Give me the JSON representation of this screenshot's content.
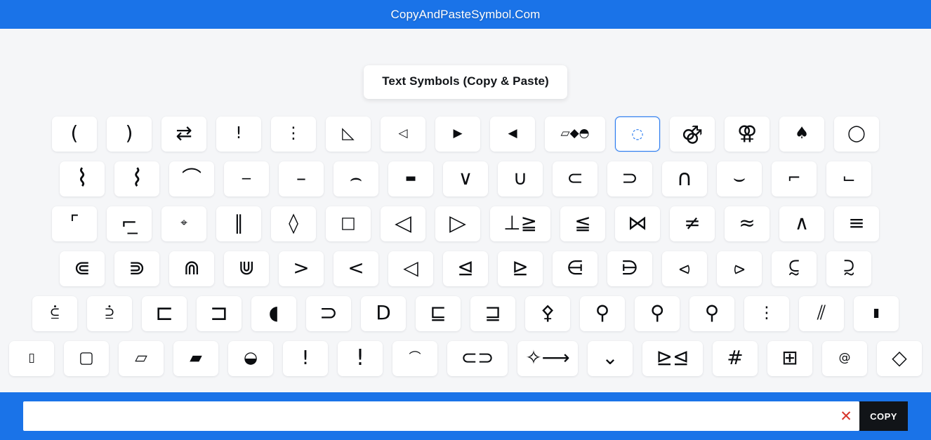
{
  "header": {
    "brand": "CopyAndPasteSymbol.Com",
    "background_color": "#1a73e8"
  },
  "title_card": {
    "heading": "Text Symbols (Copy & Paste)"
  },
  "theme": {
    "accent": "#1a73e8",
    "selected_border": "#2b7cf0",
    "page_bg": "#f5f6f8",
    "cell_bg": "#ffffff",
    "glyph_color": "#0b0d10",
    "clear_color": "#d7342a",
    "copy_bg": "#111418"
  },
  "grid": {
    "rows": [
      {
        "cells": [
          {
            "glyph": "(",
            "name": "symbol-left-paren",
            "size": "g-lg"
          },
          {
            "glyph": ")",
            "name": "symbol-right-paren",
            "size": "g-lg"
          },
          {
            "glyph": "⇄",
            "name": "symbol-rightleft-arrows",
            "size": "g-lg"
          },
          {
            "glyph": "!",
            "name": "symbol-exclamation",
            "size": ""
          },
          {
            "glyph": "⋮",
            "name": "symbol-vertical-ellipsis",
            "size": ""
          },
          {
            "glyph": "◺",
            "name": "symbol-lower-left-triangle",
            "size": ""
          },
          {
            "glyph": "◁",
            "name": "symbol-white-left-triangle",
            "size": "g-sm"
          },
          {
            "glyph": "▶",
            "name": "symbol-black-right-triangle",
            "size": "g-sm"
          },
          {
            "glyph": "◀",
            "name": "symbol-black-left-triangle",
            "size": "g-sm"
          },
          {
            "glyph": "▱◆◓",
            "name": "symbol-parallelogram-diamond-circle",
            "size": "g-sm",
            "wide": true
          },
          {
            "glyph": "◌",
            "name": "symbol-dotted-circle-selected",
            "size": "",
            "selected": true
          },
          {
            "glyph": "⚣",
            "name": "symbol-doubled-male",
            "size": "g-lg"
          },
          {
            "glyph": "⚢",
            "name": "symbol-doubled-female",
            "size": "g-lg"
          },
          {
            "glyph": "♠",
            "name": "symbol-spade",
            "size": ""
          },
          {
            "glyph": "◯",
            "name": "symbol-large-circle",
            "size": ""
          }
        ]
      },
      {
        "cells": [
          {
            "glyph": "⌇",
            "name": "symbol-wavy-line-down",
            "size": "g-tall"
          },
          {
            "glyph": "⌇",
            "name": "symbol-wavy-line-up",
            "size": "g-tall",
            "flip": true
          },
          {
            "glyph": "⌒",
            "name": "symbol-arc",
            "size": "g-lg"
          },
          {
            "glyph": "‒",
            "name": "symbol-figure-dash",
            "size": ""
          },
          {
            "glyph": "–",
            "name": "symbol-en-dash",
            "size": "g-lg"
          },
          {
            "glyph": "⌢",
            "name": "symbol-frown-arc",
            "size": "g-lg"
          },
          {
            "glyph": "▬",
            "name": "symbol-black-rectangle",
            "size": "g-sm"
          },
          {
            "glyph": "∨",
            "name": "symbol-logical-or",
            "size": "g-lg"
          },
          {
            "glyph": "∪",
            "name": "symbol-union",
            "size": "g-lg"
          },
          {
            "glyph": "⊂",
            "name": "symbol-subset-of",
            "size": "g-lg"
          },
          {
            "glyph": "⊃",
            "name": "symbol-superset-of",
            "size": "g-lg"
          },
          {
            "glyph": "∩",
            "name": "symbol-intersection",
            "size": "g-xl"
          },
          {
            "glyph": "⌣",
            "name": "symbol-smile-arc",
            "size": "g-lg"
          },
          {
            "glyph": "⌐",
            "name": "symbol-reversed-not",
            "size": ""
          },
          {
            "glyph": "⌙",
            "name": "symbol-turned-not",
            "size": ""
          }
        ]
      },
      {
        "cells": [
          {
            "glyph": "⌜",
            "name": "symbol-top-left-corner",
            "size": "g-lg"
          },
          {
            "glyph": "⌐̲",
            "name": "symbol-bottom-right-corner",
            "size": "g-lg"
          },
          {
            "glyph": "⌖",
            "name": "symbol-position-indicator",
            "size": "g-sm"
          },
          {
            "glyph": "∥",
            "name": "symbol-parallel-to",
            "size": "g-lg"
          },
          {
            "glyph": "◊",
            "name": "symbol-lozenge",
            "size": "g-lg"
          },
          {
            "glyph": "□",
            "name": "symbol-white-square",
            "size": ""
          },
          {
            "glyph": "◁",
            "name": "symbol-white-left-triangle-large",
            "size": "g-xl"
          },
          {
            "glyph": "▷",
            "name": "symbol-white-right-triangle-large",
            "size": "g-xl"
          },
          {
            "glyph": "⊥≧",
            "name": "symbol-perpendicular-greater-equal",
            "size": "g-lg",
            "wide": true
          },
          {
            "glyph": "≦",
            "name": "symbol-less-over-equal",
            "size": "g-lg"
          },
          {
            "glyph": "⋈",
            "name": "symbol-bowtie",
            "size": "g-lg"
          },
          {
            "glyph": "≠",
            "name": "symbol-not-equal",
            "size": "g-lg"
          },
          {
            "glyph": "≈",
            "name": "symbol-almost-equal",
            "size": "g-lg"
          },
          {
            "glyph": "∧",
            "name": "symbol-logical-and",
            "size": "g-lg"
          },
          {
            "glyph": "≡",
            "name": "symbol-identical-to",
            "size": "g-lg"
          }
        ]
      },
      {
        "cells": [
          {
            "glyph": "⋐",
            "name": "symbol-double-subset",
            "size": "g-lg"
          },
          {
            "glyph": "⋑",
            "name": "symbol-double-superset",
            "size": "g-lg"
          },
          {
            "glyph": "⋒",
            "name": "symbol-double-intersection",
            "size": "g-lg"
          },
          {
            "glyph": "⋓",
            "name": "symbol-double-union",
            "size": "g-lg"
          },
          {
            "glyph": ">",
            "name": "symbol-greater-than",
            "size": "g-lg"
          },
          {
            "glyph": "<",
            "name": "symbol-less-than",
            "size": "g-lg"
          },
          {
            "glyph": "◁",
            "name": "symbol-triangle-left-outline",
            "size": "g-lg"
          },
          {
            "glyph": "⊴",
            "name": "symbol-normal-subgroup-equal",
            "size": "g-lg"
          },
          {
            "glyph": "⊵",
            "name": "symbol-contains-normal-subgroup-equal",
            "size": "g-lg"
          },
          {
            "glyph": "⋳",
            "name": "symbol-element-with-dot",
            "size": "g-lg"
          },
          {
            "glyph": "⋻",
            "name": "symbol-contains-with-dot",
            "size": "g-lg"
          },
          {
            "glyph": "⪦",
            "name": "symbol-subset-with-plus",
            "size": "g-lg"
          },
          {
            "glyph": "⪧",
            "name": "symbol-superset-with-plus",
            "size": "g-lg"
          },
          {
            "glyph": "⫇",
            "name": "symbol-subset-with-times",
            "size": "g-lg"
          },
          {
            "glyph": "⫈",
            "name": "symbol-superset-with-times",
            "size": "g-lg"
          }
        ]
      },
      {
        "cells": [
          {
            "glyph": "⫃",
            "name": "symbol-subset-equal-dot",
            "size": "g-lg"
          },
          {
            "glyph": "⫄",
            "name": "symbol-superset-equal-dot",
            "size": "g-lg"
          },
          {
            "glyph": "⊏",
            "name": "symbol-square-image-of",
            "size": "g-xl"
          },
          {
            "glyph": "⊐",
            "name": "symbol-square-original-of",
            "size": "g-xl"
          },
          {
            "glyph": "◖",
            "name": "symbol-left-half-circle",
            "size": "g-lg"
          },
          {
            "glyph": "⊃",
            "name": "symbol-superset-plain",
            "size": "g-xl"
          },
          {
            "glyph": "D",
            "name": "symbol-letter-d-shape",
            "size": "g-lg"
          },
          {
            "glyph": "⊑",
            "name": "symbol-square-image-of-equal",
            "size": "g-lg"
          },
          {
            "glyph": "⊒",
            "name": "symbol-square-original-of-equal",
            "size": "g-lg"
          },
          {
            "glyph": "⚴",
            "name": "symbol-pallas",
            "size": "g-lg"
          },
          {
            "glyph": "⚲",
            "name": "symbol-neuter",
            "size": "g-lg"
          },
          {
            "glyph": "⚲",
            "name": "symbol-pin-up",
            "size": "g-lg",
            "flip": true
          },
          {
            "glyph": "⚲",
            "name": "symbol-pin-down",
            "size": "g-lg"
          },
          {
            "glyph": "⋮",
            "name": "symbol-vertical-ellipsis-2",
            "size": ""
          },
          {
            "glyph": "⫽",
            "name": "symbol-triple-solidus",
            "size": "g-lg"
          },
          {
            "glyph": "▮",
            "name": "symbol-black-vertical-rectangle",
            "size": "g-sm"
          }
        ]
      },
      {
        "cells": [
          {
            "glyph": "▯",
            "name": "symbol-white-vertical-rectangle",
            "size": "g-sm"
          },
          {
            "glyph": "▢",
            "name": "symbol-rounded-square",
            "size": ""
          },
          {
            "glyph": "▱",
            "name": "symbol-white-parallelogram",
            "size": ""
          },
          {
            "glyph": "▰",
            "name": "symbol-black-parallelogram",
            "size": ""
          },
          {
            "glyph": "◒",
            "name": "symbol-lower-half-circle",
            "size": ""
          },
          {
            "glyph": "!",
            "name": "symbol-exclamation-2",
            "size": "g-lg"
          },
          {
            "glyph": "!",
            "name": "symbol-exclamation-3",
            "size": "g-xl"
          },
          {
            "glyph": "⌒",
            "name": "symbol-small-arc",
            "size": "g-sm"
          },
          {
            "glyph": "⊂⊃",
            "name": "symbol-subset-superset-pair",
            "size": "g-lg",
            "wide": true
          },
          {
            "glyph": "✧⟶",
            "name": "symbol-diamond-arrow",
            "size": "g-lg",
            "wide": true
          },
          {
            "glyph": "⌄",
            "name": "symbol-small-wedge",
            "size": "g-lg"
          },
          {
            "glyph": "⊵⊴",
            "name": "symbol-triangle-pair",
            "size": "g-lg",
            "wide": true
          },
          {
            "glyph": "#",
            "name": "symbol-number-sign",
            "size": "g-lg"
          },
          {
            "glyph": "⊞",
            "name": "symbol-squared-plus-window",
            "size": "g-lg"
          },
          {
            "glyph": "@",
            "name": "symbol-commercial-at",
            "size": "g-sm"
          },
          {
            "glyph": "◇",
            "name": "symbol-white-diamond",
            "size": "g-lg"
          }
        ]
      }
    ]
  },
  "bottom_bar": {
    "input_value": "",
    "input_placeholder": "",
    "clear_label": "✕",
    "copy_label": "COPY"
  }
}
